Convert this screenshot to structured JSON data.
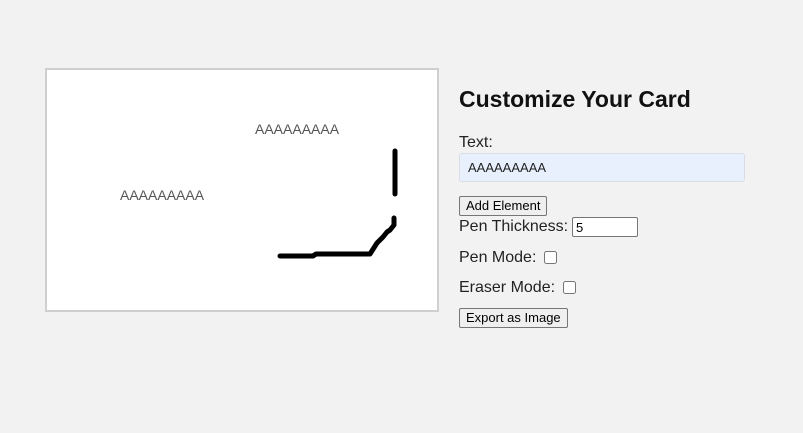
{
  "canvas": {
    "texts": [
      "AAAAAAAAA",
      "AAAAAAAAA"
    ]
  },
  "panel": {
    "title": "Customize Your Card",
    "text_label": "Text:",
    "text_value": "AAAAAAAAA",
    "add_button": "Add Element",
    "pen_thickness_label": "Pen Thickness:",
    "pen_thickness_value": "5",
    "pen_mode_label": "Pen Mode:",
    "pen_mode_checked": false,
    "eraser_mode_label": "Eraser Mode:",
    "eraser_mode_checked": false,
    "export_button": "Export as Image"
  }
}
